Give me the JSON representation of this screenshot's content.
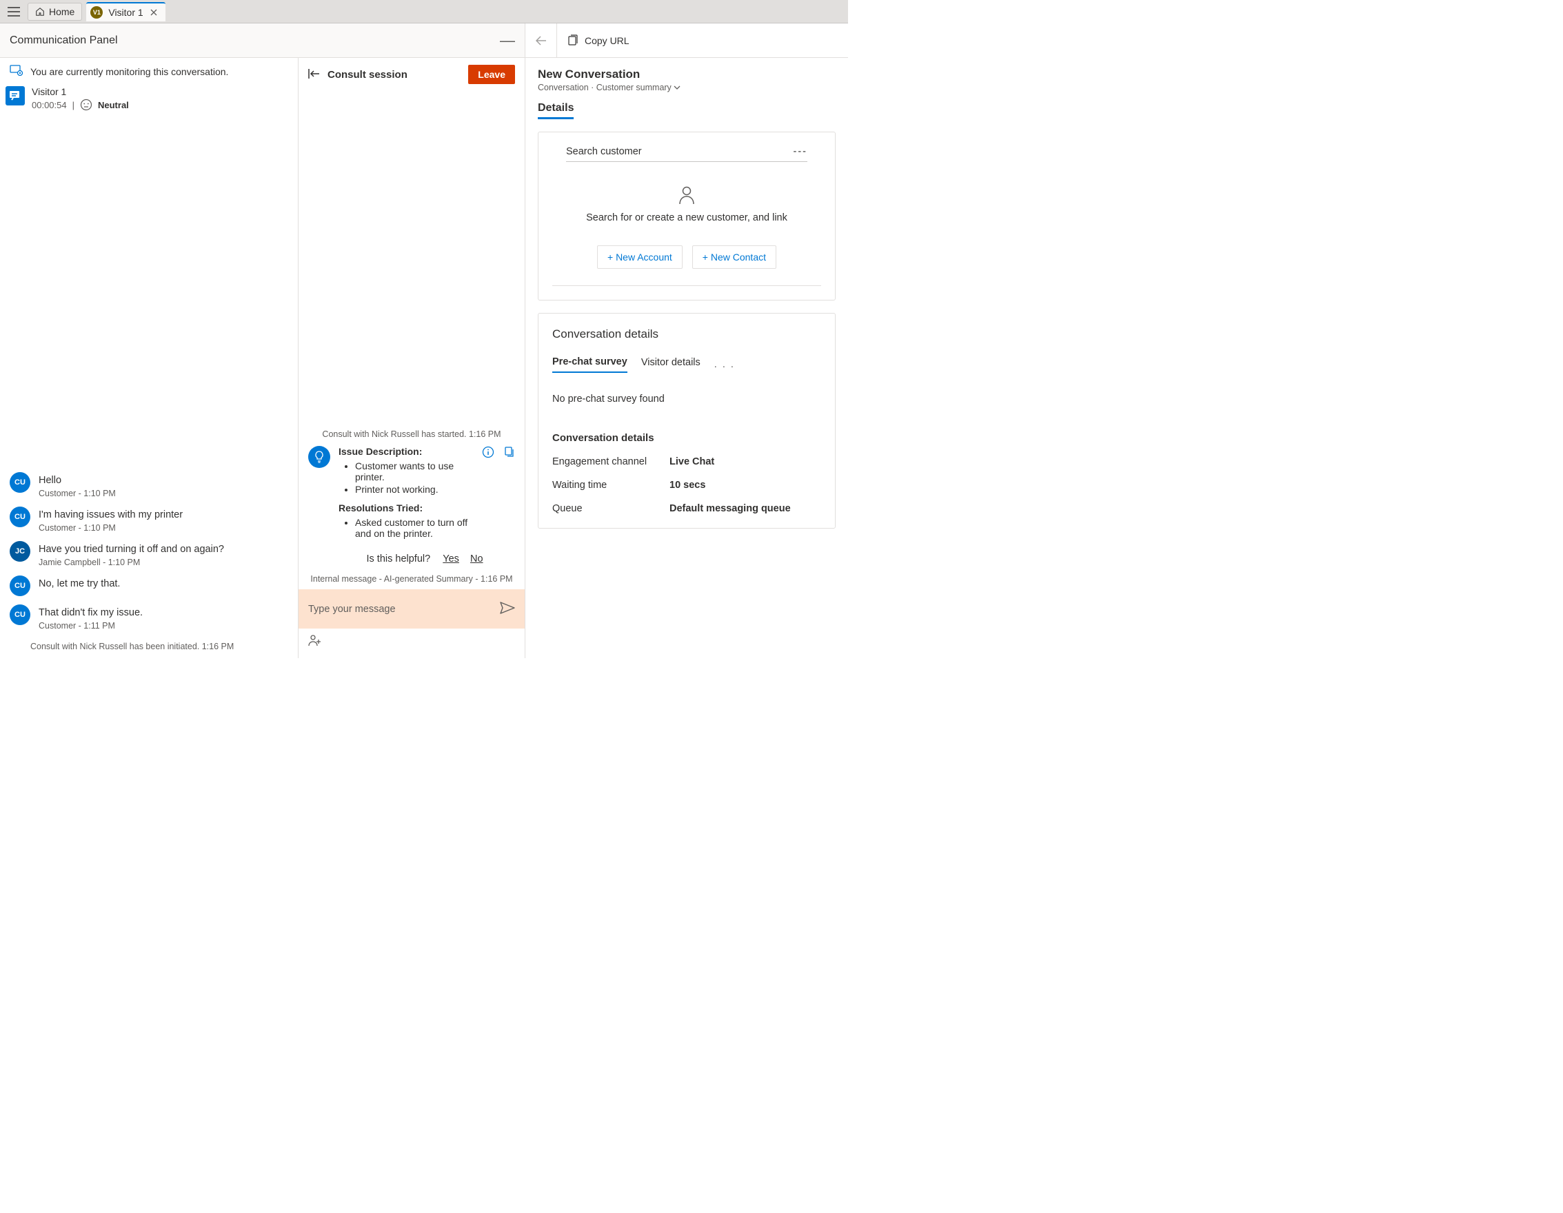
{
  "topBar": {
    "home": "Home",
    "tabAvatar": "V1",
    "tabLabel": "Visitor 1"
  },
  "commPanel": {
    "title": "Communication Panel",
    "monitoring": "You are currently monitoring this conversation.",
    "session": {
      "name": "Visitor 1",
      "timer": "00:00:54",
      "sentiment": "Neutral"
    },
    "messages": [
      {
        "avatar": "CU",
        "text": "Hello",
        "meta": "Customer - 1:10 PM"
      },
      {
        "avatar": "CU",
        "text": "I'm having issues with my printer",
        "meta": "Customer - 1:10 PM"
      },
      {
        "avatar": "JC",
        "text": "Have you tried turning it off and on again?",
        "meta": "Jamie Campbell - 1:10 PM"
      },
      {
        "avatar": "CU",
        "text": "No, let me try that.",
        "meta": ""
      },
      {
        "avatar": "CU",
        "text": "That didn't fix my issue.",
        "meta": "Customer - 1:11 PM"
      }
    ],
    "consultInitiated": "Consult with Nick Russell has been initiated. 1:16 PM"
  },
  "consult": {
    "title": "Consult session",
    "leave": "Leave",
    "started": "Consult with Nick Russell has started. 1:16 PM",
    "summary": {
      "issueHeading": "Issue Description:",
      "issues": [
        "Customer wants to use printer.",
        "Printer not working."
      ],
      "resHeading": "Resolutions Tried:",
      "resolutions": [
        "Asked customer to turn off and on the printer."
      ]
    },
    "helpful": {
      "q": "Is this helpful?",
      "yes": "Yes",
      "no": "No"
    },
    "internalMeta": "Internal message - AI-generated Summary - 1:16 PM",
    "placeholder": "Type your message"
  },
  "right": {
    "copyUrl": "Copy URL",
    "convTitle": "New Conversation",
    "convSubA": "Conversation",
    "convSubB": "Customer summary",
    "detailsTab": "Details",
    "searchCustomer": "Search customer",
    "dash": "---",
    "custPlaceholder": "Search for or create a new customer, and link",
    "newAccount": "+ New Account",
    "newContact": "+ New Contact",
    "convDetails": "Conversation details",
    "tabs": {
      "preChat": "Pre-chat survey",
      "visitor": "Visitor details"
    },
    "noSurvey": "No pre-chat survey found",
    "convDetails2": "Conversation details",
    "kv": {
      "engagementK": "Engagement channel",
      "engagementV": "Live Chat",
      "waitK": "Waiting time",
      "waitV": "10 secs",
      "queueK": "Queue",
      "queueV": "Default messaging queue"
    }
  }
}
